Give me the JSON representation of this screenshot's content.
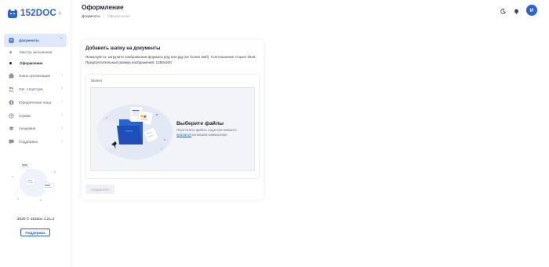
{
  "app": {
    "logo_text": "152DOC"
  },
  "sidebar": {
    "collapse_icon": "«",
    "items": [
      {
        "label": "Документы",
        "icon": "document-icon",
        "active": true,
        "expanded": true
      },
      {
        "label": "Мастер заполнения",
        "sub": true
      },
      {
        "label": "Оформление",
        "sub": true,
        "current": true
      },
      {
        "label": "Наша организация",
        "icon": "building-icon"
      },
      {
        "label": "Орг. структура",
        "icon": "people-icon"
      },
      {
        "label": "Юридические лица",
        "icon": "legal-entity-icon"
      },
      {
        "label": "Сервис",
        "icon": "gear-icon"
      },
      {
        "label": "Академия",
        "icon": "academy-icon"
      },
      {
        "label": "Поддержка",
        "icon": "chat-icon"
      }
    ],
    "version": "2020 © 152doc 1.21.2",
    "support_button": "Поддержка"
  },
  "header": {
    "title": "Оформление",
    "breadcrumb": {
      "parent": "Документы",
      "separator": "›",
      "current": "Оформление"
    },
    "avatar_letter": "И"
  },
  "card": {
    "title": "Добавить шапку на документы",
    "description": "Пожалуйста, загрузите изображения формата png или jpg (не более 2мб). Соотношение сторон 16х5. Предпочтительный размер изображения: 1280x400",
    "upload_label": "Шапка",
    "dropzone": {
      "title": "Выберите файлы",
      "text_before": "Перетяните файлы сюда или нажмите",
      "link": "просмотр",
      "text_after": "на вашем компьютере"
    },
    "save_button": "Сохранить"
  },
  "colors": {
    "accent": "#2a63d4",
    "active_bg": "#dfe8fb",
    "dropzone_bg": "#f3f4f7",
    "text": "#1f2433"
  }
}
